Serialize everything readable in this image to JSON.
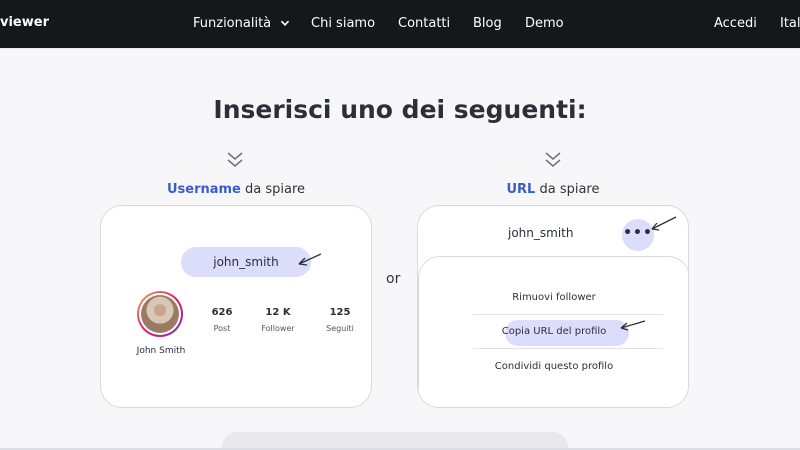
{
  "nav": {
    "logo": "viewer",
    "items": [
      "Funzionalità",
      "Chi siamo",
      "Contatti",
      "Blog",
      "Demo"
    ],
    "login": "Accedi",
    "language": "Itali"
  },
  "heading": "Inserisci uno dei seguenti:",
  "username_col": {
    "label_em": "Username",
    "label_rest": " da spiare",
    "username": "john_smith",
    "name": "John Smith",
    "stats": [
      {
        "value": "626",
        "label": "Post"
      },
      {
        "value": "12 K",
        "label": "Follower"
      },
      {
        "value": "125",
        "label": "Seguiti"
      }
    ]
  },
  "separator": "or",
  "url_col": {
    "label_em": "URL",
    "label_rest": " da spiare",
    "username": "john_smith",
    "more": "•••",
    "menu": [
      "Rimuovi follower",
      "Copia URL del profilo",
      "Condividi questo profilo"
    ]
  },
  "colors": {
    "nav_bg": "#16171b",
    "accent": "#3b5bcc",
    "pill": "#dcdcfb"
  }
}
